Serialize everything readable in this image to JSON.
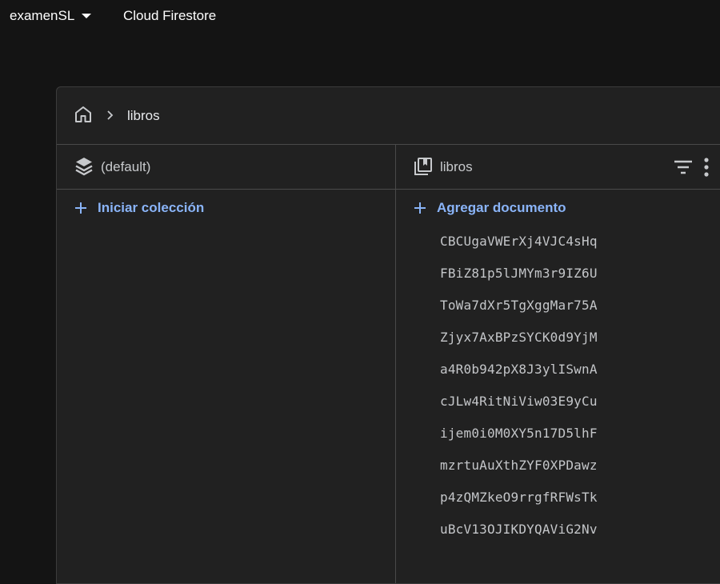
{
  "topbar": {
    "project_name": "examenSL",
    "product_name": "Cloud Firestore"
  },
  "breadcrumb": {
    "items": [
      "libros"
    ]
  },
  "database_column": {
    "title": "(default)",
    "add_label": "Iniciar colección"
  },
  "collection_column": {
    "title": "libros",
    "add_label": "Agregar documento",
    "documents": [
      "CBCUgaVWErXj4VJC4sHq",
      "FBiZ81p5lJMYm3r9IZ6U",
      "ToWa7dXr5TgXggMar75A",
      "Zjyx7AxBPzSYCK0d9YjM",
      "a4R0b942pX8J3ylISwnA",
      "cJLw4RitNiViw03E9yCu",
      "ijem0i0M0XY5n17D5lhF",
      "mzrtuAuXthZYF0XPDawz",
      "p4zQMZkeO9rrgfRFWsTk",
      "uBcV13OJIKDYQAViG2Nv"
    ]
  },
  "icons": {
    "home": "home-icon",
    "chevron": "chevron-right-icon",
    "database": "database-stack-icon",
    "collection": "collection-icon",
    "filter": "filter-icon",
    "more": "more-vert-icon",
    "add": "plus-icon",
    "dropdown": "caret-down-icon"
  },
  "colors": {
    "accent": "#8ab4f8",
    "panel_bg": "#212121",
    "page_bg": "#141414"
  }
}
